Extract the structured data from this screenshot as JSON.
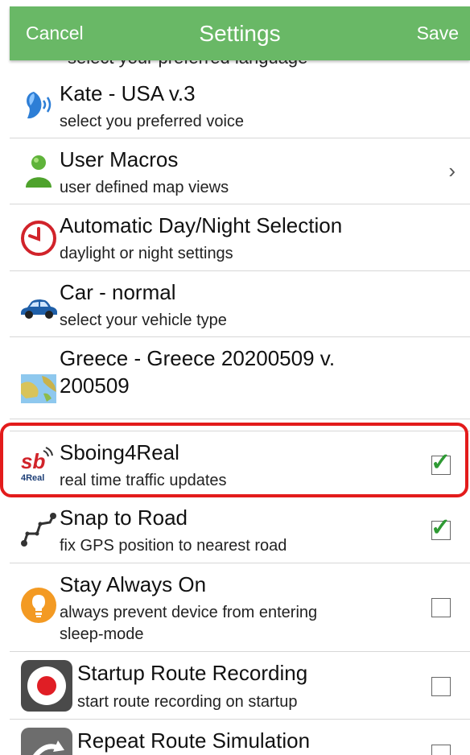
{
  "header": {
    "cancel": "Cancel",
    "title": "Settings",
    "save": "Save"
  },
  "hidden_sub": "select your preferred language",
  "rows": [
    {
      "title": "Kate - USA v.3",
      "sub": "select you preferred voice"
    },
    {
      "title": "User Macros",
      "sub": "user defined map views",
      "chevron": "›"
    },
    {
      "title": "Automatic Day/Night Selection",
      "sub": "daylight or night settings"
    },
    {
      "title": "Car - normal",
      "sub": "select your vehicle type"
    },
    {
      "title": "Greece - Greece 20200509 v.",
      "title2": "200509"
    },
    {
      "title": "Sboing4Real",
      "sub": "real time traffic updates",
      "checked": true
    },
    {
      "title": "Snap to Road",
      "sub": "fix GPS position to nearest road",
      "checked": true
    },
    {
      "title": "Stay Always On",
      "sub": "always prevent device from entering",
      "sub2": "sleep-mode",
      "checked": false
    },
    {
      "title": "Startup Route Recording",
      "sub": "start route recording on startup",
      "checked": false
    },
    {
      "title": "Repeat Route Simulation",
      "checked": false
    }
  ],
  "icons": {
    "sboing_text_top": "sb",
    "sboing_text_bottom": "4Real"
  },
  "colors": {
    "header": "#69b866",
    "highlight": "#e31b1b",
    "check": "#2f9a34"
  }
}
